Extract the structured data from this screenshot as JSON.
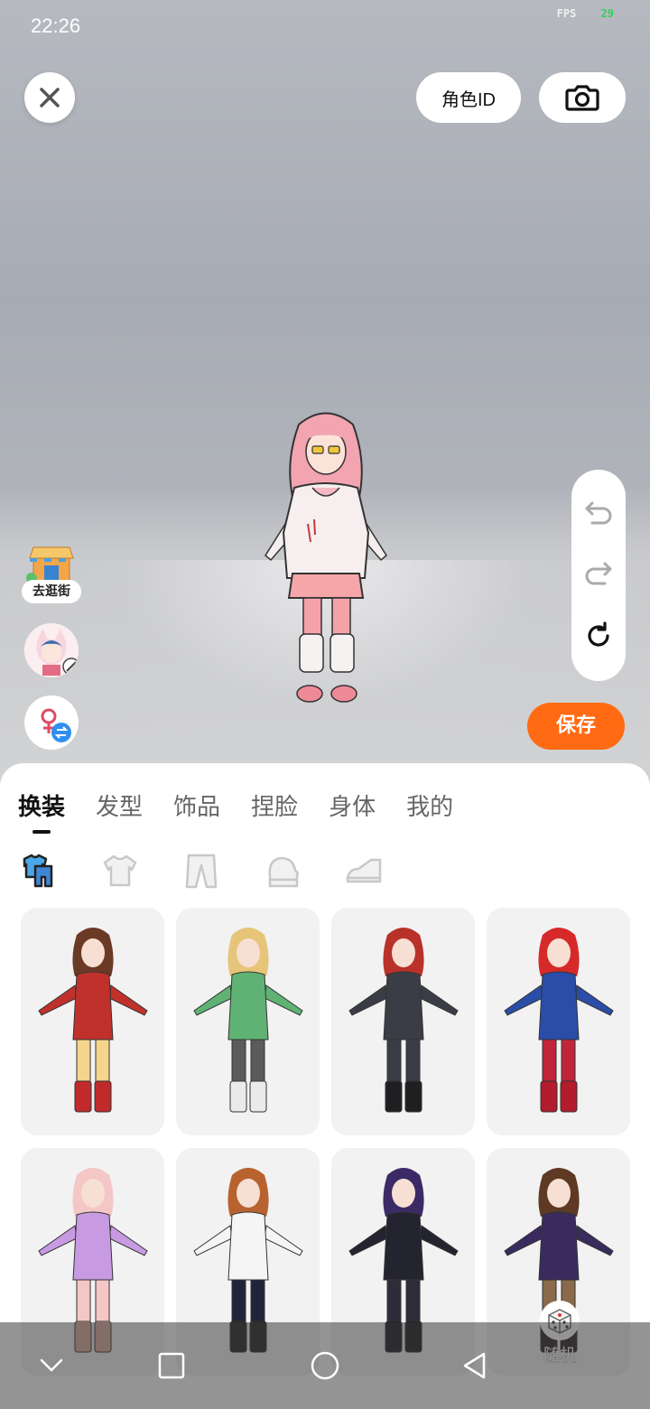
{
  "status_bar": {
    "time": "22:26",
    "fps_label": "FPS",
    "fps_value": "29"
  },
  "header": {
    "close_icon": "close-icon",
    "role_id_label": "角色ID",
    "camera_icon": "camera-icon"
  },
  "left_panel": {
    "go_street_label": "去逛街",
    "gender_icon": "female-switch-icon"
  },
  "tools": {
    "undo_icon": "undo-icon",
    "redo_icon": "redo-icon",
    "reset_icon": "reset-icon"
  },
  "save_label": "保存",
  "tabs": [
    {
      "label": "换装",
      "active": true
    },
    {
      "label": "发型",
      "active": false
    },
    {
      "label": "饰品",
      "active": false
    },
    {
      "label": "捏脸",
      "active": false
    },
    {
      "label": "身体",
      "active": false
    },
    {
      "label": "我的",
      "active": false
    }
  ],
  "subcategories": [
    "outfit-icon",
    "top-icon",
    "pants-icon",
    "gloves-icon",
    "shoes-icon"
  ],
  "outfits": [
    {
      "name": "outfit-wonder",
      "hair": "#6b3a24",
      "body": "#c0312c",
      "legs": "#f5d58b",
      "boots": "#c12a2a"
    },
    {
      "name": "outfit-green-kimono",
      "hair": "#e6c57a",
      "body": "#5fb274",
      "legs": "#5b5b5b",
      "boots": "#eaeaea"
    },
    {
      "name": "outfit-black-suit",
      "hair": "#b8322a",
      "body": "#3a3d45",
      "legs": "#3a3d45",
      "boots": "#1f1f22"
    },
    {
      "name": "outfit-captain",
      "hair": "#d62a2a",
      "body": "#2a4da8",
      "legs": "#c1243b",
      "boots": "#b21c2c"
    },
    {
      "name": "outfit-cat-dress",
      "hair": "#f4c6c6",
      "body": "#c79ae2",
      "legs": "#f4c6c6",
      "boots": "#d9a99c"
    },
    {
      "name": "outfit-sport",
      "hair": "#b8632f",
      "body": "#f5f5f5",
      "legs": "#20243a",
      "boots": "#222"
    },
    {
      "name": "outfit-gothic",
      "hair": "#3b2a66",
      "body": "#242430",
      "legs": "#2d2d3a",
      "boots": "#1a1a1f"
    },
    {
      "name": "outfit-robe",
      "hair": "#5e3a24",
      "body": "#3a2b5e",
      "legs": "#8a6a4a",
      "boots": "#2a2222"
    }
  ],
  "random_label": "随机",
  "nav": {
    "back_icon": "chevron-down-icon",
    "recent_icon": "square-icon",
    "home_icon": "circle-icon",
    "return_icon": "triangle-back-icon"
  }
}
